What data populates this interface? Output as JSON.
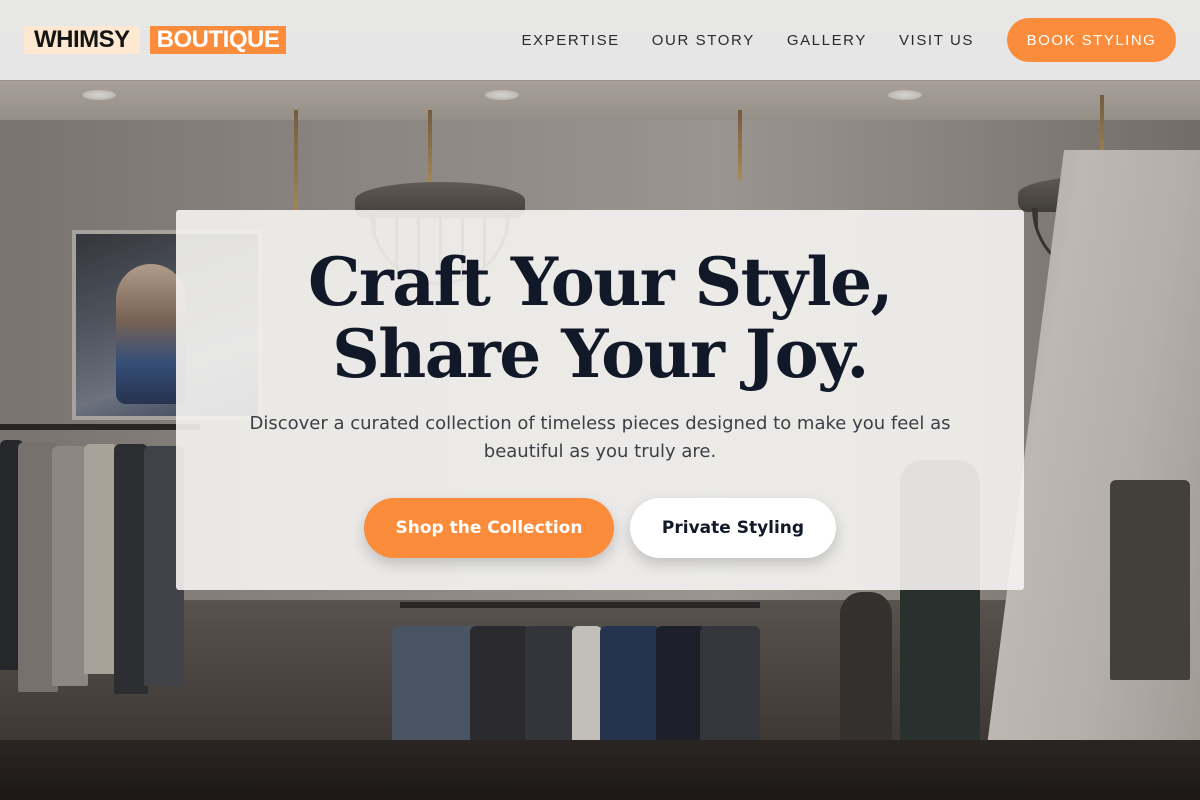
{
  "brand": {
    "logo_part1": "WHIMSY",
    "logo_part2": "BOUTIQUE"
  },
  "nav": {
    "items": [
      {
        "label": "EXPERTISE"
      },
      {
        "label": "OUR STORY"
      },
      {
        "label": "GALLERY"
      },
      {
        "label": "VISIT US"
      }
    ],
    "cta_label": "BOOK STYLING"
  },
  "hero": {
    "title_line1": "Craft Your Style,",
    "title_line2": "Share Your Joy.",
    "subtitle": "Discover a curated collection of timeless pieces designed to make you feel as beautiful as you truly are.",
    "primary_label": "Shop the Collection",
    "secondary_label": "Private Styling"
  },
  "colors": {
    "accent": "#fb8c3c",
    "logo_highlight": "#fde8d2",
    "heading": "#111827",
    "header_bg": "#ececec"
  },
  "background": {
    "description_icon": "boutique-interior-photo"
  }
}
